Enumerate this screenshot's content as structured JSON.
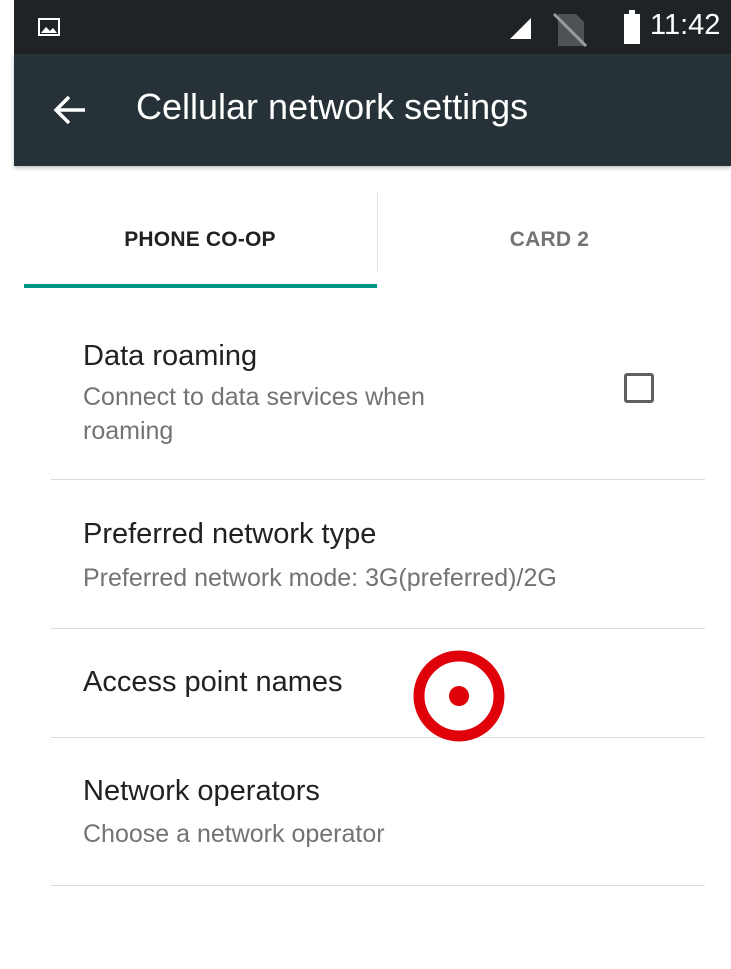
{
  "status_bar": {
    "time": "11:42",
    "icons": [
      "gallery-icon",
      "signal-icon",
      "no-sim-icon",
      "battery-icon"
    ]
  },
  "app_bar": {
    "title": "Cellular network settings",
    "back_icon": "arrow-back-icon"
  },
  "tabs": [
    {
      "label": "PHONE CO-OP",
      "selected": true
    },
    {
      "label": "CARD 2",
      "selected": false
    }
  ],
  "preferences": {
    "data_roaming": {
      "title": "Data roaming",
      "summary": "Connect to data services when roaming",
      "checked": false
    },
    "preferred_network_type": {
      "title": "Preferred network type",
      "summary": "Preferred network mode: 3G(preferred)/2G"
    },
    "access_point_names": {
      "title": "Access point names"
    },
    "network_operators": {
      "title": "Network operators",
      "summary": "Choose a network operator"
    }
  },
  "colors": {
    "status_bar": "#1f2326",
    "app_bar": "#263238",
    "tab_indicator": "#009688",
    "touch_indicator": "#e0000a"
  }
}
